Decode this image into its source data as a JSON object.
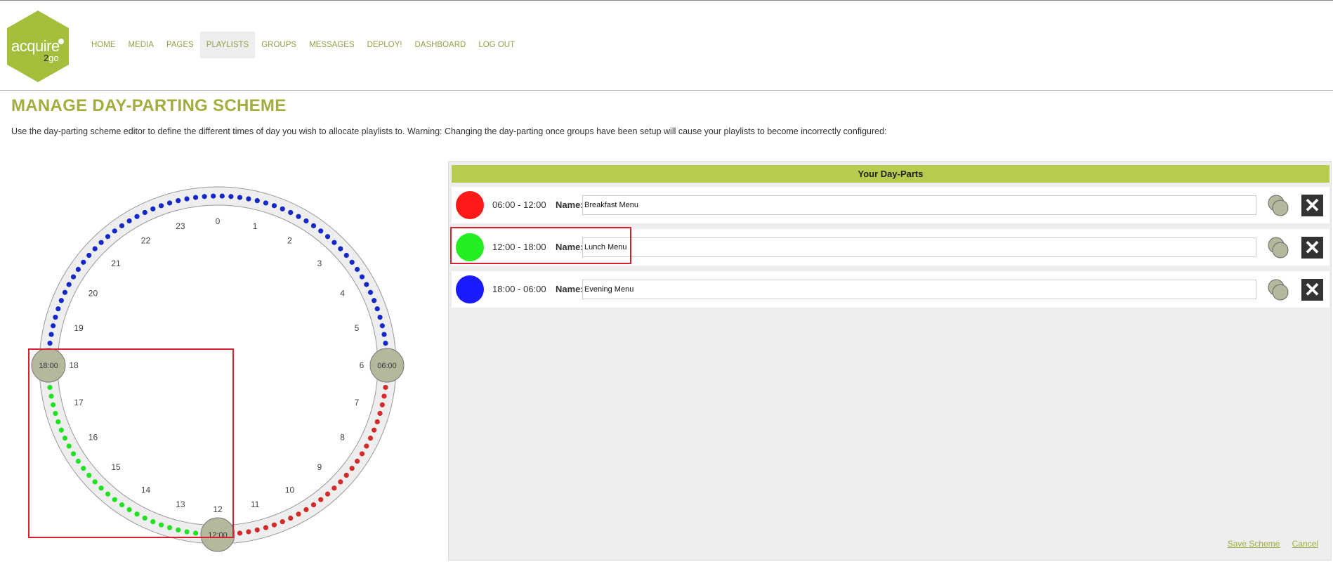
{
  "logo": {
    "text": "acquire",
    "sub_prefix": "2",
    "sub_suffix": "go",
    "color": "#a3bf3b"
  },
  "nav": [
    "HOME",
    "MEDIA",
    "PAGES",
    "PLAYLISTS",
    "GROUPS",
    "MESSAGES",
    "DEPLOY!",
    "DASHBOARD",
    "LOG OUT"
  ],
  "nav_active": "PLAYLISTS",
  "page": {
    "title": "MANAGE DAY-PARTING SCHEME",
    "intro": "Use the day-parting scheme editor to define the different times of day you wish to allocate playlists to. Warning: Changing the day-parting once groups have been setup will cause your playlists to become incorrectly configured:"
  },
  "clock": {
    "hours": [
      "0",
      "1",
      "2",
      "3",
      "4",
      "5",
      "6",
      "7",
      "8",
      "9",
      "10",
      "11",
      "12",
      "13",
      "14",
      "15",
      "16",
      "17",
      "18",
      "19",
      "20",
      "21",
      "22",
      "23"
    ],
    "handles": [
      "06:00",
      "12:00",
      "18:00"
    ],
    "segments": [
      {
        "start": 6,
        "end": 12,
        "color": "#d32a2a"
      },
      {
        "start": 12,
        "end": 18,
        "color": "#22e022"
      },
      {
        "start": 18,
        "end": 30,
        "color": "#1428c8"
      }
    ]
  },
  "panel": {
    "header": "Your Day-Parts",
    "name_label": "Name:",
    "rows": [
      {
        "time": "06:00 - 12:00",
        "name": "Breakfast Menu",
        "color": "#ff1a1a"
      },
      {
        "time": "12:00 - 18:00",
        "name": "Lunch Menu",
        "color": "#22ee22"
      },
      {
        "time": "18:00 - 06:00",
        "name": "Evening Menu",
        "color": "#1a1aff"
      }
    ]
  },
  "footer": {
    "save": "Save Scheme",
    "cancel": "Cancel"
  },
  "colors": {
    "accent": "#a3ac3f",
    "highlight": "#d6202f"
  }
}
